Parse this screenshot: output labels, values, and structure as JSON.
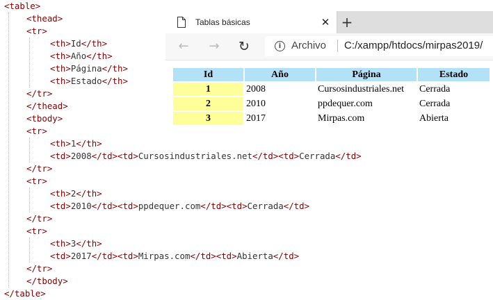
{
  "code_lines": [
    {
      "indent": 0,
      "parts": [
        {
          "t": "tag",
          "v": "<table>"
        }
      ]
    },
    {
      "indent": 1,
      "parts": [
        {
          "t": "tag",
          "v": "<thead>"
        }
      ]
    },
    {
      "indent": 1,
      "parts": [
        {
          "t": "tag",
          "v": "<tr>"
        }
      ]
    },
    {
      "indent": 2,
      "parts": [
        {
          "t": "tag",
          "v": "<th>"
        },
        {
          "t": "txt",
          "v": "Id"
        },
        {
          "t": "tag",
          "v": "</th>"
        }
      ]
    },
    {
      "indent": 2,
      "parts": [
        {
          "t": "tag",
          "v": "<th>"
        },
        {
          "t": "txt",
          "v": "Año"
        },
        {
          "t": "tag",
          "v": "</th>"
        }
      ]
    },
    {
      "indent": 2,
      "parts": [
        {
          "t": "tag",
          "v": "<th>"
        },
        {
          "t": "txt",
          "v": "Página"
        },
        {
          "t": "tag",
          "v": "</th>"
        }
      ]
    },
    {
      "indent": 2,
      "parts": [
        {
          "t": "tag",
          "v": "<th>"
        },
        {
          "t": "txt",
          "v": "Estado"
        },
        {
          "t": "tag",
          "v": "</th>"
        }
      ]
    },
    {
      "indent": 1,
      "parts": [
        {
          "t": "tag",
          "v": "</tr>"
        }
      ]
    },
    {
      "indent": 1,
      "parts": [
        {
          "t": "tag",
          "v": "</thead>"
        }
      ]
    },
    {
      "indent": 1,
      "parts": [
        {
          "t": "tag",
          "v": "<tbody>"
        }
      ]
    },
    {
      "indent": 1,
      "parts": [
        {
          "t": "tag",
          "v": "<tr>"
        }
      ]
    },
    {
      "indent": 2,
      "parts": [
        {
          "t": "tag",
          "v": "<th>"
        },
        {
          "t": "txt",
          "v": "1"
        },
        {
          "t": "tag",
          "v": "</th>"
        }
      ]
    },
    {
      "indent": 2,
      "parts": [
        {
          "t": "tag",
          "v": "<td>"
        },
        {
          "t": "txt",
          "v": "2008"
        },
        {
          "t": "tag",
          "v": "</td>"
        },
        {
          "t": "tag",
          "v": "<td>"
        },
        {
          "t": "txt",
          "v": "Cursosindustriales.net"
        },
        {
          "t": "tag",
          "v": "</td>"
        },
        {
          "t": "tag",
          "v": "<td>"
        },
        {
          "t": "txt",
          "v": "Cerrada"
        },
        {
          "t": "tag",
          "v": "</td>"
        }
      ]
    },
    {
      "indent": 1,
      "parts": [
        {
          "t": "tag",
          "v": "</tr>"
        }
      ]
    },
    {
      "indent": 1,
      "parts": [
        {
          "t": "tag",
          "v": "<tr>"
        }
      ]
    },
    {
      "indent": 2,
      "parts": [
        {
          "t": "tag",
          "v": "<th>"
        },
        {
          "t": "txt",
          "v": "2"
        },
        {
          "t": "tag",
          "v": "</th>"
        }
      ]
    },
    {
      "indent": 2,
      "parts": [
        {
          "t": "tag",
          "v": "<td>"
        },
        {
          "t": "txt",
          "v": "2010"
        },
        {
          "t": "tag",
          "v": "</td>"
        },
        {
          "t": "tag",
          "v": "<td>"
        },
        {
          "t": "txt",
          "v": "ppdequer.com"
        },
        {
          "t": "tag",
          "v": "</td>"
        },
        {
          "t": "tag",
          "v": "<td>"
        },
        {
          "t": "txt",
          "v": "Cerrada"
        },
        {
          "t": "tag",
          "v": "</td>"
        }
      ]
    },
    {
      "indent": 1,
      "parts": [
        {
          "t": "tag",
          "v": "</tr>"
        }
      ]
    },
    {
      "indent": 1,
      "parts": [
        {
          "t": "tag",
          "v": "<tr>"
        }
      ]
    },
    {
      "indent": 2,
      "parts": [
        {
          "t": "tag",
          "v": "<th>"
        },
        {
          "t": "txt",
          "v": "3"
        },
        {
          "t": "tag",
          "v": "</th>"
        }
      ]
    },
    {
      "indent": 2,
      "parts": [
        {
          "t": "tag",
          "v": "<td>"
        },
        {
          "t": "txt",
          "v": "2017"
        },
        {
          "t": "tag",
          "v": "</td>"
        },
        {
          "t": "tag",
          "v": "<td>"
        },
        {
          "t": "txt",
          "v": "Mirpas.com"
        },
        {
          "t": "tag",
          "v": "</td>"
        },
        {
          "t": "tag",
          "v": "<td>"
        },
        {
          "t": "txt",
          "v": "Abierta"
        },
        {
          "t": "tag",
          "v": "</td>"
        }
      ]
    },
    {
      "indent": 1,
      "parts": [
        {
          "t": "tag",
          "v": "</tr>"
        }
      ]
    },
    {
      "indent": 1,
      "parts": [
        {
          "t": "tag",
          "v": "</tbody>"
        }
      ]
    },
    {
      "indent": 0,
      "parts": [
        {
          "t": "tag",
          "v": "</table>"
        }
      ]
    }
  ],
  "colors": {
    "code_tag": "#800000",
    "code_text": "#333333",
    "header_cell_bg": "#b3e1f7",
    "row_header_bg": "#ffff99"
  },
  "browser": {
    "tab": {
      "title": "Tablas básicas",
      "icon": "page-icon",
      "close_icon": "close-icon",
      "close_label": "✕"
    },
    "new_tab": {
      "icon": "plus-icon",
      "label": "+"
    },
    "nav": {
      "back": {
        "icon": "arrow-left-icon",
        "label": "←"
      },
      "forward": {
        "icon": "arrow-right-icon",
        "label": "→"
      },
      "reload": {
        "icon": "reload-icon",
        "label": "↻"
      }
    },
    "address": {
      "info_icon": "info-icon",
      "info_label": "i",
      "label": "Archivo",
      "url": "C:/xampp/htdocs/mirpas2019/"
    }
  },
  "table": {
    "headers": [
      "Id",
      "Año",
      "Página",
      "Estado"
    ],
    "rows": [
      {
        "id": "1",
        "anio": "2008",
        "pagina": "Cursosindustriales.net",
        "estado": "Cerrada"
      },
      {
        "id": "2",
        "anio": "2010",
        "pagina": "ppdequer.com",
        "estado": "Cerrada"
      },
      {
        "id": "3",
        "anio": "2017",
        "pagina": "Mirpas.com",
        "estado": "Abierta"
      }
    ]
  }
}
